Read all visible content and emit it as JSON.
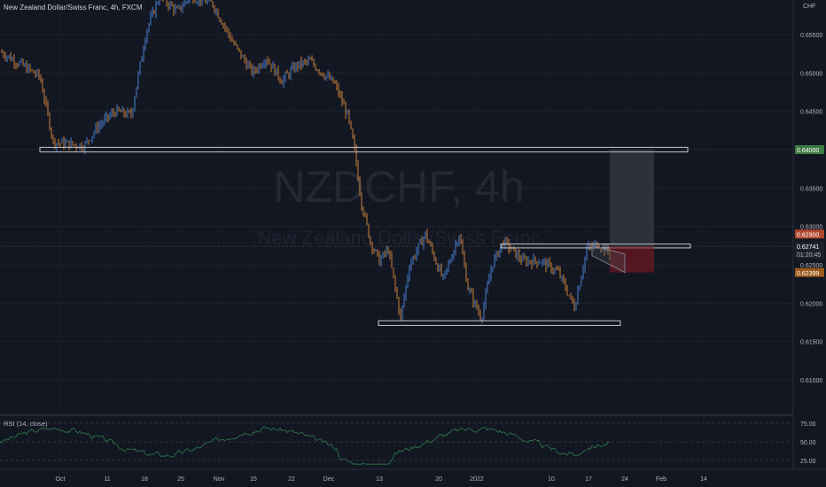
{
  "symbol": {
    "legend": "New Zealand Dollar/Swiss Franc, 4h, FXCM",
    "watermark_ticker": "NZDCHF, 4h",
    "watermark_name": "New Zealand Dollar/Swiss Franc",
    "currency": "CHF"
  },
  "price_axis": {
    "ticks": [
      "0.65500",
      "0.65000",
      "0.64500",
      "0.64000",
      "0.63500",
      "0.63000",
      "0.62500",
      "0.62000",
      "0.61500",
      "0.61000"
    ],
    "range": [
      0.6055,
      0.6595
    ]
  },
  "price_badges": {
    "target": "0.64000",
    "stop": "0.62900",
    "last_price": "0.62741",
    "countdown": "01:20:45",
    "entry": "0.62399"
  },
  "rsi": {
    "legend": "RSI (14, close)",
    "ticks": [
      "75.00",
      "50.00",
      "25.00"
    ]
  },
  "time_axis": {
    "labels": [
      "Oct",
      "11",
      "18",
      "25",
      "Nov",
      "15",
      "22",
      "Dec",
      "13",
      "20",
      "2022",
      "10",
      "17",
      "24",
      "Feb",
      "14"
    ]
  },
  "colors": {
    "background": "#131722",
    "up_candle": "#4a7fd0",
    "down_candle": "#c8803a",
    "rsi_line": "#2e7d4a",
    "target_badge": "#3e7a43",
    "stop_badge": "#b2472f",
    "entry_badge": "#9c5a1b",
    "zone_outline": "#c8c8c8"
  }
}
